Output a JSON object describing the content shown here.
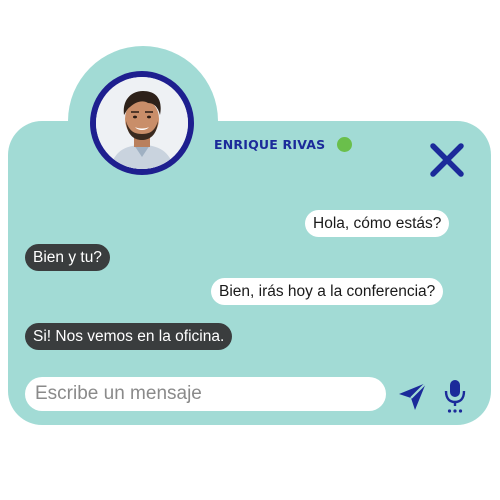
{
  "theme": {
    "panel_color": "#a2dbd5",
    "accent_color": "#1b2a9a",
    "avatar_ring_color": "#1e1f8f",
    "online_color": "#6abf4b",
    "incoming_bubble_color": "#3a3d3e",
    "outgoing_bubble_color": "#ffffff"
  },
  "contact": {
    "name": "ENRIQUE RIVAS",
    "status": "online",
    "avatar_icon": "profile-photo"
  },
  "header": {
    "close_icon": "close-icon"
  },
  "messages": [
    {
      "direction": "outgoing",
      "text": "Hola, cómo estás?"
    },
    {
      "direction": "incoming",
      "text": "Bien y tu?"
    },
    {
      "direction": "outgoing",
      "text": "Bien, irás hoy a la conferencia?"
    },
    {
      "direction": "incoming",
      "text": "Si! Nos vemos en la oficina."
    }
  ],
  "composer": {
    "placeholder": "Escribe un mensaje",
    "value": "",
    "send_icon": "send-icon",
    "mic_icon": "microphone-icon"
  }
}
